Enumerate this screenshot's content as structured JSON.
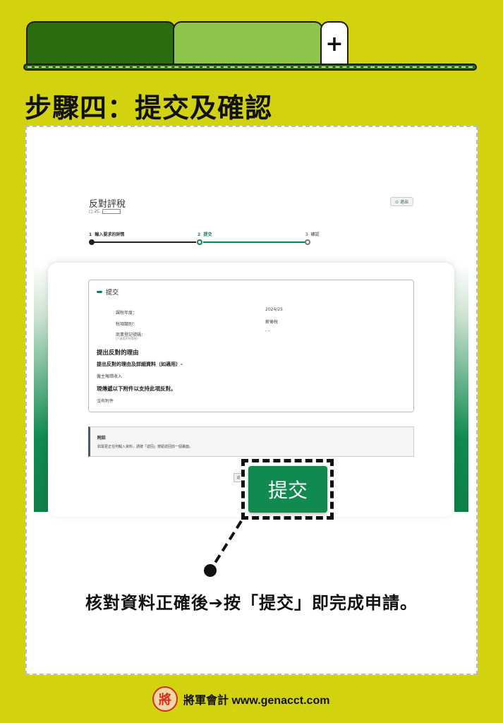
{
  "header": {
    "add_tab_symbol": "+",
    "step_title": "步驟四：提交及確認"
  },
  "form": {
    "title": "反對評稅",
    "subtitle_prefix": "□ 2C",
    "logout_label": "⊙ 退出",
    "stepper": [
      {
        "num": "1",
        "label": "輸入要求的詳情",
        "state": "done"
      },
      {
        "num": "2",
        "label": "提交",
        "state": "current"
      },
      {
        "num": "3",
        "label": "確認",
        "state": "todo"
      }
    ],
    "submit_panel": {
      "heading": "提交",
      "rows": [
        {
          "label": "課稅年度：",
          "value": "2024/25"
        },
        {
          "label": "稅項類別：",
          "value": "薪俸稅"
        },
        {
          "label": "商業登記號碼：",
          "note": "(只適用於利得稅)",
          "value": "- -"
        }
      ],
      "reason_title": "提出反對的理由",
      "reason_subtitle": "提出反對的理由及詳細資料（如適用）-",
      "reason_value": "僱主報錯收入",
      "attach_title": "現傳遞以下附件以支持此項反對。",
      "attach_value": "沒有附件"
    },
    "note": {
      "title": "附註",
      "body": "如需更正任何輸入資料，請按「返回」按鈕返回前一個畫面。"
    },
    "back_peek": "返",
    "submit_button": "提交"
  },
  "instruction": "核對資料正確後➔按「提交」即完成申請。",
  "footer": {
    "seal_char": "將",
    "text": "將軍會計 www.genacct.com"
  },
  "colors": {
    "background": "#d3d20f",
    "dark_green": "#2a6e0f",
    "light_green": "#8cc54a",
    "button_green": "#108a4f",
    "seal_red": "#d92a1c"
  }
}
